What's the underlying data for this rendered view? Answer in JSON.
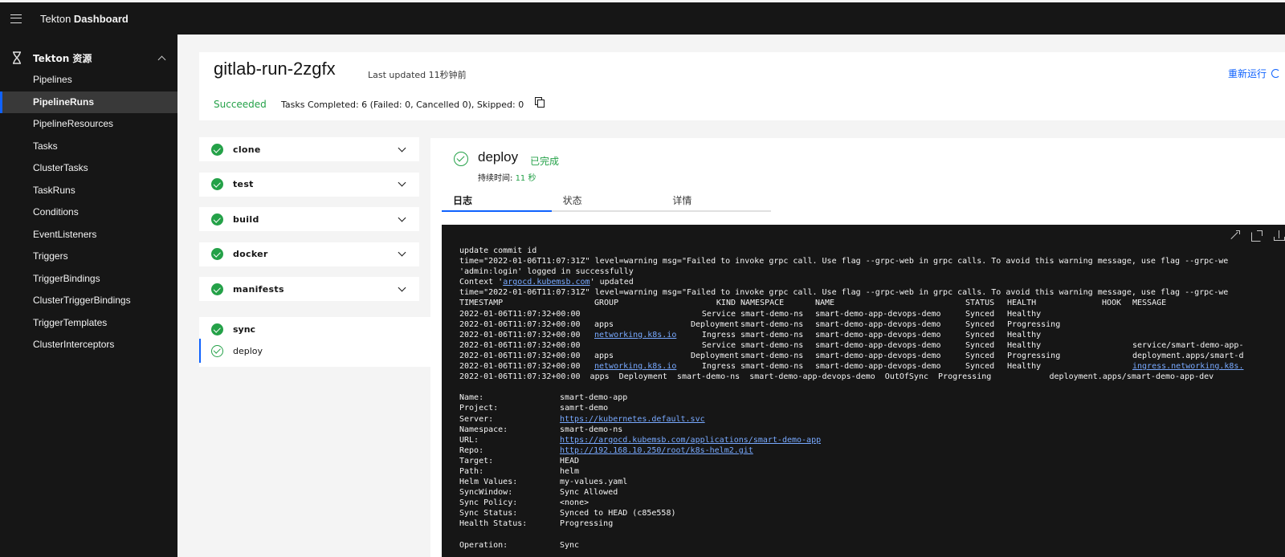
{
  "header": {
    "brand_normal": "Tekton ",
    "brand_bold": "Dashboard"
  },
  "sidebar": {
    "section_title": "Tekton 资源",
    "items": [
      {
        "label": "Pipelines",
        "active": false
      },
      {
        "label": "PipelineRuns",
        "active": true
      },
      {
        "label": "PipelineResources",
        "active": false
      },
      {
        "label": "Tasks",
        "active": false
      },
      {
        "label": "ClusterTasks",
        "active": false
      },
      {
        "label": "TaskRuns",
        "active": false
      },
      {
        "label": "Conditions",
        "active": false
      },
      {
        "label": "EventListeners",
        "active": false
      },
      {
        "label": "Triggers",
        "active": false
      },
      {
        "label": "TriggerBindings",
        "active": false
      },
      {
        "label": "ClusterTriggerBindings",
        "active": false
      },
      {
        "label": "TriggerTemplates",
        "active": false
      },
      {
        "label": "ClusterInterceptors",
        "active": false
      }
    ]
  },
  "run": {
    "title": "gitlab-run-2zgfx",
    "last_updated": "Last updated 11秒钟前",
    "rerun_label": "重新运行",
    "status": "Succeeded",
    "tasks_summary": "Tasks Completed: 6 (Failed: 0, Cancelled 0), Skipped: 0"
  },
  "tasks": [
    "clone",
    "test",
    "build",
    "docker",
    "manifests"
  ],
  "expanded_task": "sync",
  "steps": [
    {
      "label": "deploy",
      "selected": true
    }
  ],
  "detail": {
    "title": "deploy",
    "state": "已完成",
    "duration_label": "持续时间: ",
    "duration_value": "11 秒",
    "tabs": [
      {
        "label": "日志",
        "active": true
      },
      {
        "label": "状态",
        "active": false
      },
      {
        "label": "详情",
        "active": false
      }
    ]
  },
  "log": {
    "pre": [
      [
        {
          "t": "update commit id"
        }
      ],
      [
        {
          "t": "time=\"2022-01-06T11:07:31Z\" level=warning msg=\"Failed to invoke grpc call. Use flag --grpc-web in grpc calls. To avoid this warning message, use flag --grpc-we"
        }
      ],
      [
        {
          "t": "'admin:login' logged in successfully"
        }
      ],
      [
        {
          "t": "Context '"
        },
        {
          "t": "argocd.kubemsb.com",
          "link": true
        },
        {
          "t": "' updated"
        }
      ],
      [
        {
          "t": "time=\"2022-01-06T11:07:31Z\" level=warning msg=\"Failed to invoke grpc call. Use flag --grpc-web in grpc calls. To avoid this warning message, use flag --grpc-we"
        }
      ]
    ],
    "table_header": [
      "TIMESTAMP",
      "GROUP",
      "KIND",
      "NAMESPACE",
      "NAME",
      "STATUS",
      "HEALTH",
      "HOOK",
      "MESSAGE"
    ],
    "table_rows": [
      {
        "ts": "2022-01-06T11:07:32+00:00",
        "group": "",
        "kind": "Service",
        "ns": "smart-demo-ns",
        "name": "smart-demo-app-devops-demo",
        "status": "Synced",
        "health": "Healthy",
        "hook": "",
        "msg": ""
      },
      {
        "ts": "2022-01-06T11:07:32+00:00",
        "group": "apps",
        "kind": "Deployment",
        "ns": "smart-demo-ns",
        "name": "smart-demo-app-devops-demo",
        "status": "Synced",
        "health": "Progressing",
        "hook": "",
        "msg": ""
      },
      {
        "ts": "2022-01-06T11:07:32+00:00",
        "group": "networking.k8s.io",
        "group_link": true,
        "kind": "Ingress",
        "ns": "smart-demo-ns",
        "name": "smart-demo-app-devops-demo",
        "status": "Synced",
        "health": "Healthy",
        "hook": "",
        "msg": ""
      },
      {
        "ts": "2022-01-06T11:07:32+00:00",
        "group": "",
        "kind": "Service",
        "ns": "smart-demo-ns",
        "name": "smart-demo-app-devops-demo",
        "status": "Synced",
        "health": "Healthy",
        "hook": "",
        "msg": "service/smart-demo-app-"
      },
      {
        "ts": "2022-01-06T11:07:32+00:00",
        "group": "apps",
        "kind": "Deployment",
        "ns": "smart-demo-ns",
        "name": "smart-demo-app-devops-demo",
        "status": "Synced",
        "health": "Progressing",
        "hook": "",
        "msg": "deployment.apps/smart-d"
      },
      {
        "ts": "2022-01-06T11:07:32+00:00",
        "group": "networking.k8s.io",
        "group_link": true,
        "kind": "Ingress",
        "ns": "smart-demo-ns",
        "name": "smart-demo-app-devops-demo",
        "status": "Synced",
        "health": "Healthy",
        "hook": "",
        "msg": "ingress.networking.k8s.",
        "msg_link": true
      }
    ],
    "last_row": "2022-01-06T11:07:32+00:00  apps  Deployment  smart-demo-ns  smart-demo-app-devops-demo  OutOfSync  Progressing            deployment.apps/smart-demo-app-dev",
    "info": [
      {
        "key": "Name:",
        "value": "smart-demo-app"
      },
      {
        "key": "Project:",
        "value": "samrt-demo"
      },
      {
        "key": "Server:",
        "value": "https://kubernetes.default.svc",
        "link": true
      },
      {
        "key": "Namespace:",
        "value": "smart-demo-ns"
      },
      {
        "key": "URL:",
        "value": "https://argocd.kubemsb.com/applications/smart-demo-app",
        "link": true
      },
      {
        "key": "Repo:",
        "value": "http://192.168.10.250/root/k8s-helm2.git",
        "link": true
      },
      {
        "key": "Target:",
        "value": "HEAD"
      },
      {
        "key": "Path:",
        "value": "helm"
      },
      {
        "key": "Helm Values:",
        "value": "my-values.yaml"
      },
      {
        "key": "SyncWindow:",
        "value": "Sync Allowed"
      },
      {
        "key": "Sync Policy:",
        "value": "<none>"
      },
      {
        "key": "Sync Status:",
        "value": "Synced to HEAD (c85e558)"
      },
      {
        "key": "Health Status:",
        "value": "Progressing"
      }
    ],
    "operation": {
      "key": "Operation:",
      "value": "Sync"
    }
  }
}
